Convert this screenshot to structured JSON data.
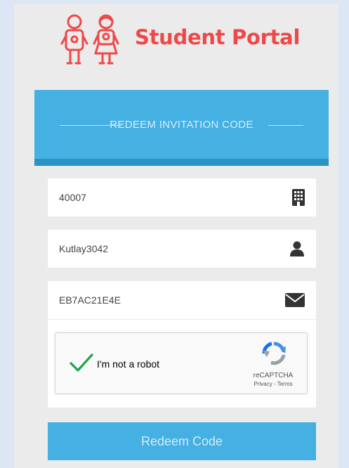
{
  "brand": {
    "title": "Student Portal",
    "color": "#ef4848",
    "logo_icon": "kids-icon"
  },
  "panel": {
    "title": "REDEEM INVITATION CODE",
    "header_color": "#45b0e2"
  },
  "fields": [
    {
      "value": "40007",
      "icon": "building-icon"
    },
    {
      "value": "Kutlay3042",
      "icon": "user-icon"
    },
    {
      "value": "EB7AC21E4E",
      "icon": "envelope-icon"
    }
  ],
  "captcha": {
    "label": "I'm not a robot",
    "brand": "reCAPTCHA",
    "links": "Privacy - Terms",
    "checked": true
  },
  "submit": {
    "label": "Redeem Code"
  }
}
